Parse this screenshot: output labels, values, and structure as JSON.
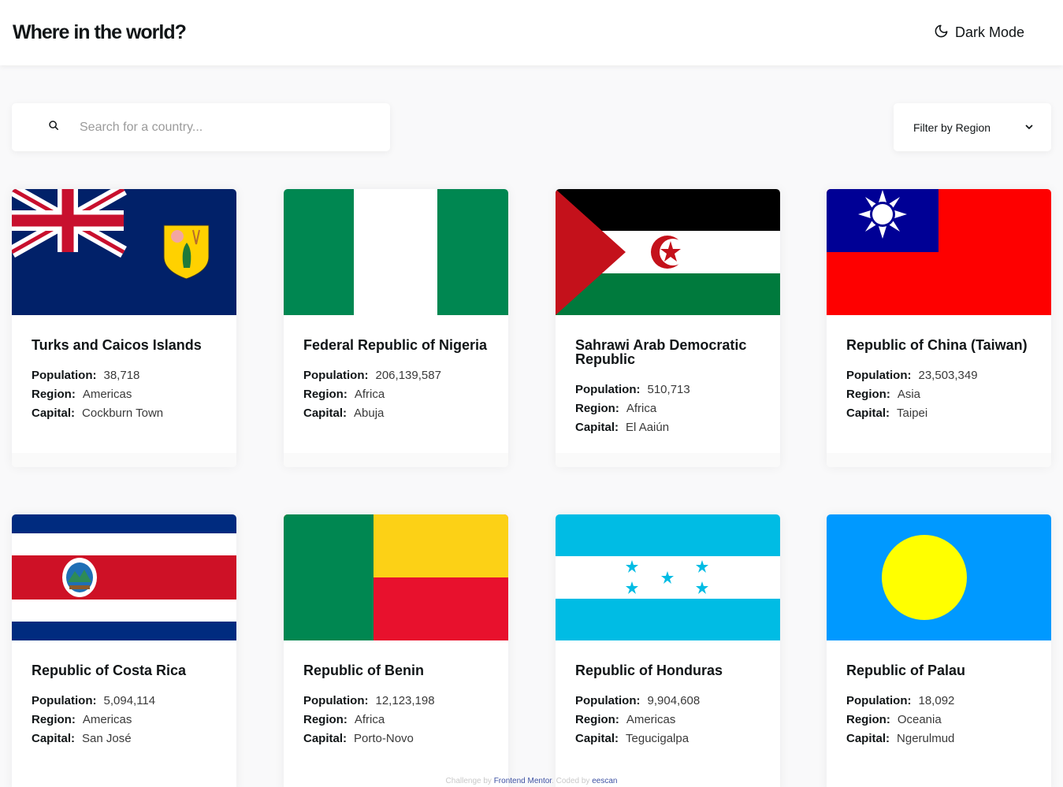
{
  "header": {
    "title": "Where in the world?",
    "theme_toggle_label": "Dark Mode",
    "theme_icon": "moon-icon"
  },
  "search": {
    "placeholder": "Search for a country...",
    "value": "",
    "icon": "search-icon"
  },
  "filter": {
    "label": "Filter by Region",
    "icon": "chevron-down-icon"
  },
  "labels": {
    "population": "Population:",
    "region": "Region:",
    "capital": "Capital:"
  },
  "countries": [
    {
      "name": "Turks and Caicos Islands",
      "population": "38,718",
      "region": "Americas",
      "capital": "Cockburn Town",
      "flag": "turks-caicos-flag"
    },
    {
      "name": "Federal Republic of Nigeria",
      "population": "206,139,587",
      "region": "Africa",
      "capital": "Abuja",
      "flag": "nigeria-flag"
    },
    {
      "name": "Sahrawi Arab Democratic Republic",
      "population": "510,713",
      "region": "Africa",
      "capital": "El Aaiún",
      "flag": "sahrawi-flag"
    },
    {
      "name": "Republic of China (Taiwan)",
      "population": "23,503,349",
      "region": "Asia",
      "capital": "Taipei",
      "flag": "taiwan-flag"
    },
    {
      "name": "Republic of Costa Rica",
      "population": "5,094,114",
      "region": "Americas",
      "capital": "San José",
      "flag": "costa-rica-flag"
    },
    {
      "name": "Republic of Benin",
      "population": "12,123,198",
      "region": "Africa",
      "capital": "Porto-Novo",
      "flag": "benin-flag"
    },
    {
      "name": "Republic of Honduras",
      "population": "9,904,608",
      "region": "Americas",
      "capital": "Tegucigalpa",
      "flag": "honduras-flag"
    },
    {
      "name": "Republic of Palau",
      "population": "18,092",
      "region": "Oceania",
      "capital": "Ngerulmud",
      "flag": "palau-flag"
    }
  ],
  "footer": {
    "prefix": "Challenge by",
    "fm_link": "Frontend Mentor",
    "middle": ". Coded by",
    "author_link": "eescan"
  }
}
